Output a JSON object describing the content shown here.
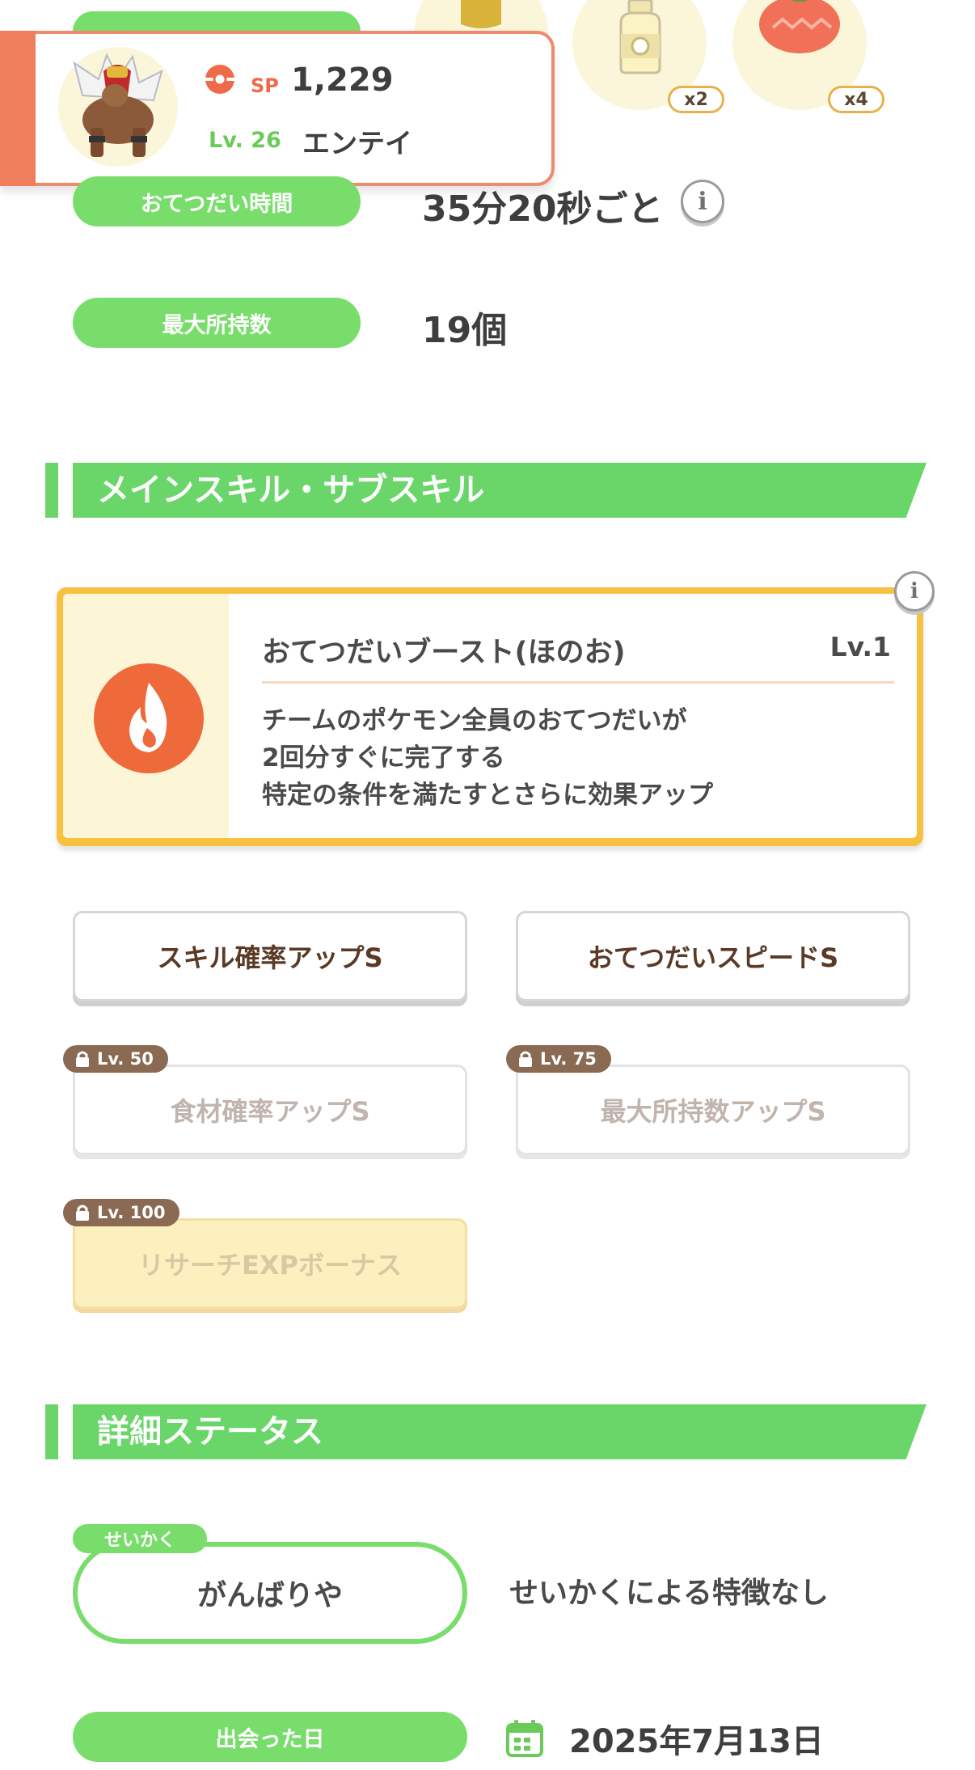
{
  "top_ingredients": [
    {
      "icon": "olive-oil-icon",
      "qty": ""
    },
    {
      "icon": "milk-bottle-icon",
      "qty": "x2"
    },
    {
      "icon": "tomato-icon",
      "qty": "x4"
    }
  ],
  "pokemon": {
    "sp_label": "SP",
    "sp_value": "1,229",
    "level": "Lv. 26",
    "name": "エンテイ"
  },
  "help_time": {
    "label": "おてつだい時間",
    "value": "35分20秒ごと"
  },
  "max_carry": {
    "label": "最大所持数",
    "value": "19個"
  },
  "skills_section": {
    "title": "メインスキル・サブスキル"
  },
  "main_skill": {
    "name": "おてつだいブースト(ほのお)",
    "level": "Lv.1",
    "description": [
      "チームのポケモン全員のおてつだいが",
      "2回分すぐに完了する",
      "特定の条件を満たすとさらに効果アップ"
    ]
  },
  "sub_skills": [
    {
      "label": "スキル確率アップS",
      "lock": ""
    },
    {
      "label": "おてつだいスピードS",
      "lock": ""
    },
    {
      "label": "食材確率アップS",
      "lock": "Lv. 50"
    },
    {
      "label": "最大所持数アップS",
      "lock": "Lv. 75"
    },
    {
      "label": "リサーチEXPボーナス",
      "lock": "Lv. 100"
    }
  ],
  "details_section": {
    "title": "詳細ステータス"
  },
  "nature": {
    "tag": "せいかく",
    "value": "がんばりや",
    "effect": "せいかくによる特徴なし"
  },
  "met_date": {
    "label": "出会った日",
    "value": "2025年7月13日"
  },
  "colors": {
    "green": "#78dd6a",
    "card_accent": "#ef7e5c",
    "skill_border": "#f8c040",
    "fire": "#ef6a3a"
  }
}
